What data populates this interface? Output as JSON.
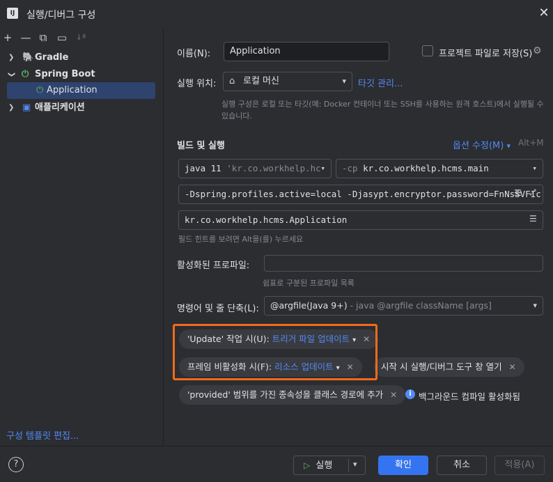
{
  "window": {
    "title": "실행/디버그 구성",
    "logo": "IJ"
  },
  "toolbar": {
    "add_icon": "+",
    "remove_icon": "—",
    "copy_icon": "⧉",
    "folder_icon": "▭",
    "sort_icon": "↓ª"
  },
  "tree": {
    "gradle": "Gradle",
    "spring_boot": "Spring Boot",
    "application": "Application",
    "app_type": "애플리케이션"
  },
  "templates_link": "구성 템플릿 편집...",
  "form": {
    "name_label": "이름(N):",
    "name_value": "Application",
    "store_label": "프로젝트 파일로 저장(S)",
    "run_on_label": "실행 위치:",
    "run_on_value": "로컬 머신",
    "manage_targets": "타깃 관리...",
    "run_on_hint": "실행 구성은 로컬 또는 타깃(예: Docker 컨테이너 또는 SSH를 사용하는 원격 호스트)에서 실행될 수 있습니다.",
    "build_run_title": "빌드 및 실행",
    "modify_options": "옵션 수정(M)",
    "modify_shortcut": "Alt+M",
    "jdk_value": "java 11",
    "jdk_hint": "'kr.co.workhelp.hc",
    "cp_flag": "-cp",
    "cp_value": "kr.co.workhelp.hcms.main",
    "vm_options": "-Dspring.profiles.active=local -Djasypt.encryptor.password=FnNsSVFIc",
    "main_class": "kr.co.workhelp.hcms.Application",
    "field_hint": "필드 힌트를 보려면 Alt을(를) 누르세요",
    "profiles_label": "활성화된 프로파일:",
    "profiles_value": "",
    "profiles_hint": "쉼표로 구분된 프로파일 목록",
    "shorten_label": "명령어 및 줄 단축(L):",
    "shorten_value": "@argfile(Java 9+)",
    "shorten_hint": "- java @argfile className [args]"
  },
  "chips": {
    "update_label": "'Update' 작업 시(U):",
    "update_value": "트리거 파일 업데이트",
    "frame_label": "프레임 비활성화 시(F):",
    "frame_value": "리소스 업데이트",
    "open_tool": "시작 시 실행/디버그 도구 창 열기",
    "provided": "'provided' 범위를 가진 종속성을 클래스 경로에 추가",
    "bg_compile": "백그라운드 컴파일 활성화됨"
  },
  "footer": {
    "help": "?",
    "run": "실행",
    "ok": "확인",
    "cancel": "취소",
    "apply": "적용(A)"
  },
  "colors": {
    "accent": "#3574f0",
    "link": "#548af7",
    "highlight": "#f36a1b",
    "run_green": "#5fb865"
  }
}
